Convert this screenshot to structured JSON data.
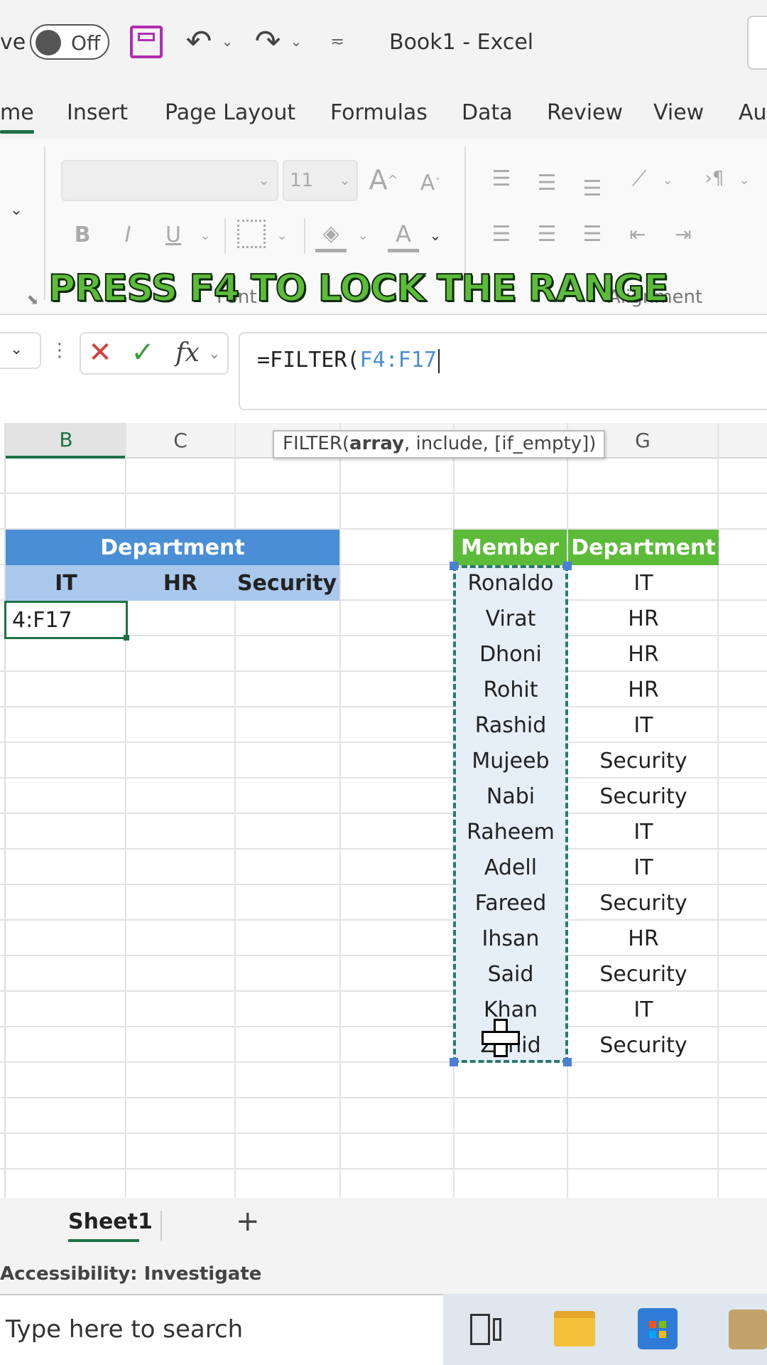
{
  "titlebar": {
    "autosave_label": "ve",
    "toggle_label": "Off",
    "title": "Book1  -  Excel"
  },
  "tabs": [
    "me",
    "Insert",
    "Page Layout",
    "Formulas",
    "Data",
    "Review",
    "View",
    "Au"
  ],
  "ribbon": {
    "font_name": "",
    "font_size": "11",
    "group_font": "Font",
    "group_alignment": "Alignment"
  },
  "caption": "PRESS F4 TO LOCK THE RANGE",
  "formula_bar": {
    "formula_prefix": "=FILTER(",
    "formula_range": "F4:F17",
    "tooltip_fn": "FILTER(",
    "tooltip_arg1": "array",
    "tooltip_rest": ", include, [if_empty])"
  },
  "columns": [
    "B",
    "C",
    "G"
  ],
  "left_table": {
    "header": "Department",
    "subheaders": [
      "IT",
      "HR",
      "Security"
    ],
    "active_cell_text": "4:F17"
  },
  "right_table": {
    "headers": [
      "Member",
      "Department"
    ],
    "rows": [
      {
        "member": "Ronaldo",
        "dept": "IT"
      },
      {
        "member": "Virat",
        "dept": "HR"
      },
      {
        "member": "Dhoni",
        "dept": "HR"
      },
      {
        "member": "Rohit",
        "dept": "HR"
      },
      {
        "member": "Rashid",
        "dept": "IT"
      },
      {
        "member": "Mujeeb",
        "dept": "Security"
      },
      {
        "member": "Nabi",
        "dept": "Security"
      },
      {
        "member": "Raheem",
        "dept": "IT"
      },
      {
        "member": "Adell",
        "dept": "IT"
      },
      {
        "member": "Fareed",
        "dept": "Security"
      },
      {
        "member": "Ihsan",
        "dept": "HR"
      },
      {
        "member": "Said",
        "dept": "Security"
      },
      {
        "member": "Khan",
        "dept": "IT"
      },
      {
        "member": "Zahid",
        "dept": "Security"
      }
    ]
  },
  "sheet_tab": "Sheet1",
  "add_sheet": "+",
  "status": "Accessibility: Investigate",
  "taskbar": {
    "search_placeholder": "Type here to search"
  },
  "colors": {
    "accent_green": "#1e7145",
    "dept_header_blue": "#4a8fd6",
    "dept_sub_blue": "#a9c8ec",
    "member_header_green": "#5dbb3a",
    "selection_fill": "#e6eef8"
  }
}
